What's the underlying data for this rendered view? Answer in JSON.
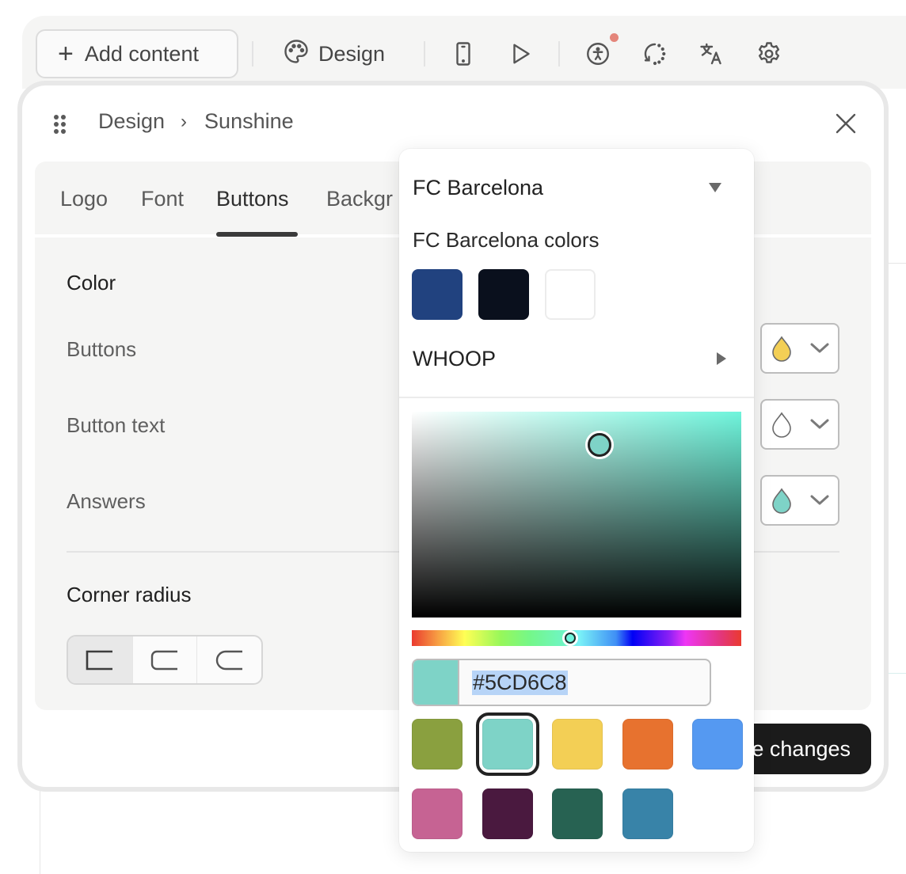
{
  "toolbar": {
    "add_content_label": "Add content",
    "design_label": "Design",
    "icons": [
      "plus-icon",
      "palette-icon",
      "mobile-preview-icon",
      "play-icon",
      "accessibility-icon",
      "history-icon",
      "translate-icon",
      "settings-icon"
    ],
    "accessibility_notification": true,
    "notification_color": "#E4857A"
  },
  "panel": {
    "breadcrumb": [
      "Design",
      "Sunshine"
    ],
    "tabs": [
      {
        "label": "Logo",
        "active": false
      },
      {
        "label": "Font",
        "active": false
      },
      {
        "label": "Buttons",
        "active": true
      },
      {
        "label": "Backgr",
        "active": false
      }
    ],
    "color_section": {
      "title": "Color",
      "rows": [
        {
          "label": "Buttons",
          "color": "#F3CF55"
        },
        {
          "label": "Button text",
          "color": "#FFFFFF"
        },
        {
          "label": "Answers",
          "color": "#7ED3C7"
        }
      ]
    },
    "corner_radius": {
      "title": "Corner radius",
      "options": [
        "square",
        "rounded",
        "more-rounded"
      ],
      "selected": "square"
    },
    "save_label": "Save changes"
  },
  "picker": {
    "brand_select": "FC Barcelona",
    "brand_palette_title": "FC Barcelona colors",
    "brand_colors": [
      "#21427F",
      "#0A101D",
      "#FFFFFF"
    ],
    "other_brand": "WHOOP",
    "hue_color": "#6FF5DC",
    "hex_value": "#5CD6C8",
    "preview_color": "#7ED3C7",
    "presets": [
      {
        "color": "#8AA03F",
        "selected": false
      },
      {
        "color": "#7ED3C7",
        "selected": true
      },
      {
        "color": "#F3CF55",
        "selected": false
      },
      {
        "color": "#E7722F",
        "selected": false
      },
      {
        "color": "#5599F1",
        "selected": false
      },
      {
        "color": "#C66393",
        "selected": false
      },
      {
        "color": "#4A193F",
        "selected": false
      },
      {
        "color": "#276252",
        "selected": false
      },
      {
        "color": "#3883A8",
        "selected": false
      }
    ]
  }
}
